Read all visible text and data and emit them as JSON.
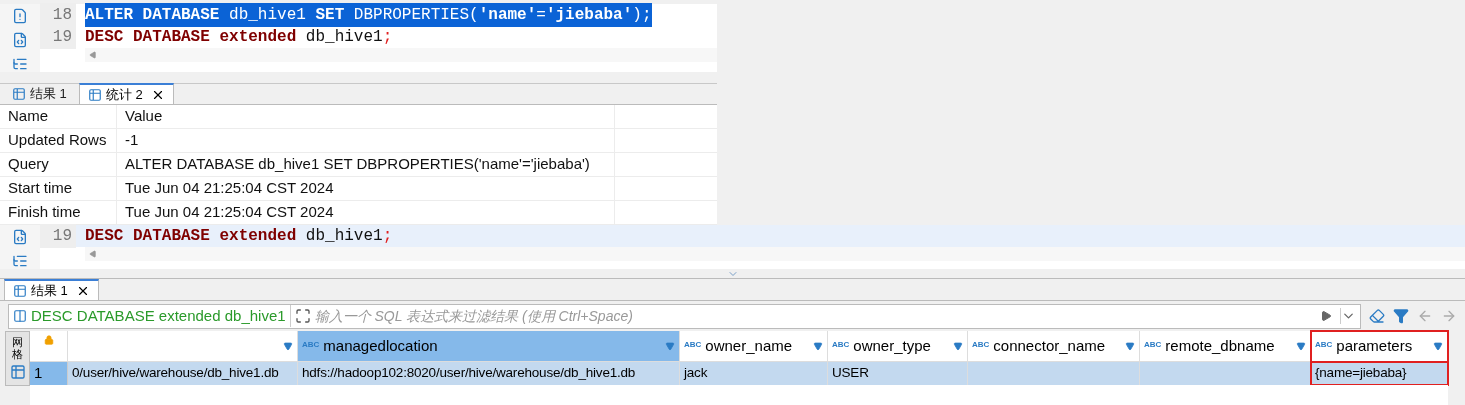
{
  "editor_top": {
    "lines": [
      {
        "number": "18",
        "selected": true,
        "current": false,
        "tokens": [
          {
            "kind": "keyword",
            "text": "ALTER DATABASE"
          },
          {
            "kind": "plain",
            "text": " db_hive1 "
          },
          {
            "kind": "keyword",
            "text": "SET"
          },
          {
            "kind": "plain",
            "text": " DBPROPERTIES("
          },
          {
            "kind": "string",
            "text": "'name'"
          },
          {
            "kind": "plain",
            "text": "="
          },
          {
            "kind": "string",
            "text": "'jiebaba'"
          },
          {
            "kind": "plain",
            "text": ");"
          }
        ]
      },
      {
        "number": "19",
        "selected": false,
        "current": false,
        "tokens": [
          {
            "kind": "keyword",
            "text": "DESC DATABASE extended"
          },
          {
            "kind": "plain",
            "text": " db_hive1"
          },
          {
            "kind": "punct",
            "text": ";"
          }
        ]
      }
    ]
  },
  "stats_tabs": [
    {
      "label": "结果 1",
      "selected": false,
      "closable": false
    },
    {
      "label": "统计 2",
      "selected": true,
      "closable": true
    }
  ],
  "stats_table": {
    "columns": [
      "Name",
      "Value"
    ],
    "rows": [
      [
        "Updated Rows",
        "-1"
      ],
      [
        "Query",
        "ALTER DATABASE db_hive1 SET DBPROPERTIES('name'='jiebaba')"
      ],
      [
        "Start time",
        "Tue Jun 04 21:25:04 CST 2024"
      ],
      [
        "Finish time",
        "Tue Jun 04 21:25:04 CST 2024"
      ]
    ]
  },
  "editor_bottom": {
    "lines": [
      {
        "number": "19",
        "selected": false,
        "current": true,
        "tokens": [
          {
            "kind": "keyword",
            "text": "DESC DATABASE extended"
          },
          {
            "kind": "plain",
            "text": " db_hive1"
          },
          {
            "kind": "punct",
            "text": ";"
          }
        ]
      }
    ]
  },
  "result_tabs": [
    {
      "label": "结果 1",
      "selected": true,
      "closable": true
    }
  ],
  "filter": {
    "query": "DESC DATABASE extended db_hive1",
    "placeholder": "输入一个 SQL 表达式来过滤结果 (使用 Ctrl+Space)"
  },
  "grid": {
    "side_tab": "网格",
    "columns": [
      {
        "selected": false,
        "annotated": false
      },
      {
        "label": "managedlocation",
        "type_label": "ABC",
        "selected": true,
        "annotated": false
      },
      {
        "label": "owner_name",
        "type_label": "ABC",
        "selected": false,
        "annotated": false
      },
      {
        "label": "owner_type",
        "type_label": "ABC",
        "selected": false,
        "annotated": false
      },
      {
        "label": "connector_name",
        "type_label": "ABC",
        "selected": false,
        "annotated": false
      },
      {
        "label": "remote_dbname",
        "type_label": "ABC",
        "selected": false,
        "annotated": false
      },
      {
        "label": "parameters",
        "type_label": "ABC",
        "selected": false,
        "annotated": true
      }
    ],
    "rows": [
      {
        "number": "1",
        "selected": true,
        "cells": [
          "0/user/hive/warehouse/db_hive1.db",
          "hdfs://hadoop102:8020/user/hive/warehouse/db_hive1.db",
          "jack",
          "USER",
          "",
          "",
          "{name=jiebaba}"
        ]
      }
    ]
  }
}
